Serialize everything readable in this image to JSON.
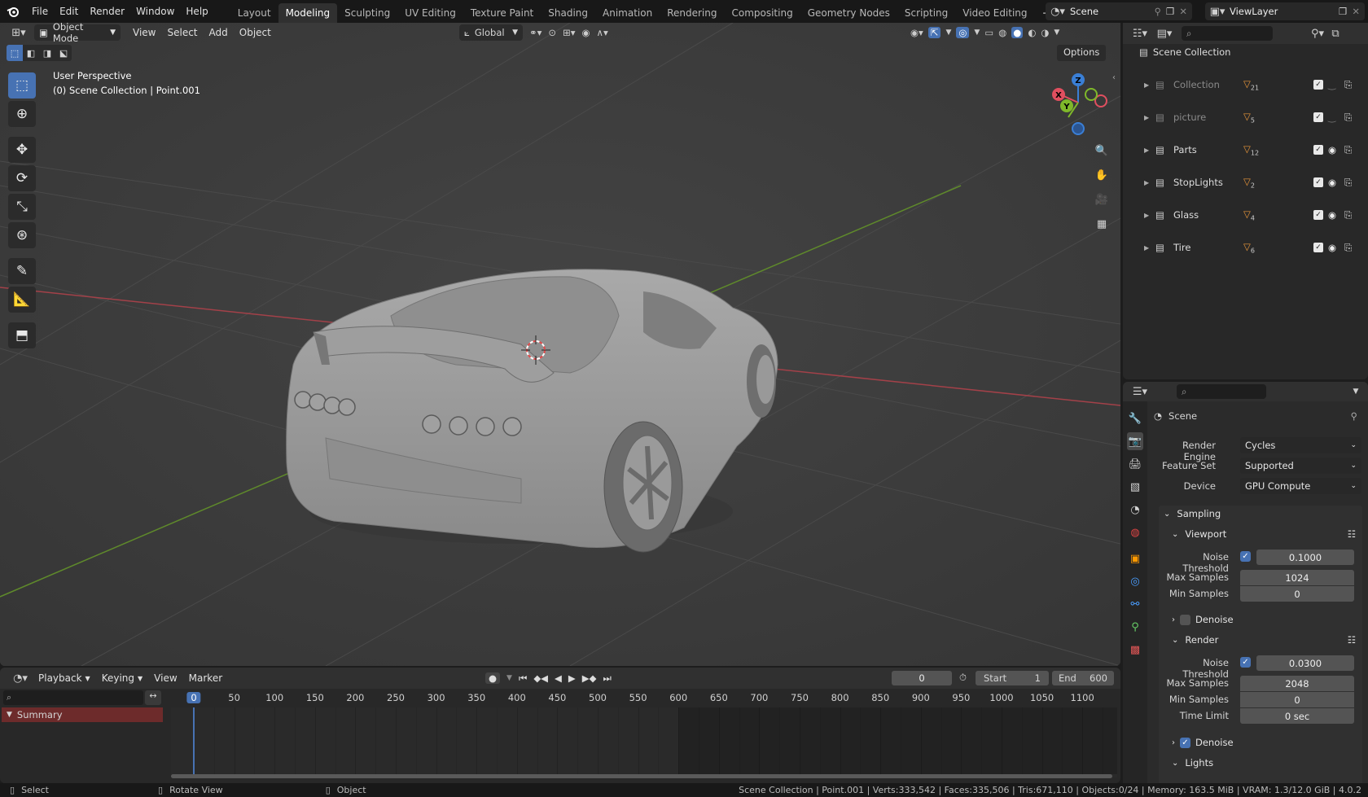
{
  "topbar": {
    "menus": [
      "File",
      "Edit",
      "Render",
      "Window",
      "Help"
    ],
    "workspaces": [
      "Layout",
      "Modeling",
      "Sculpting",
      "UV Editing",
      "Texture Paint",
      "Shading",
      "Animation",
      "Rendering",
      "Compositing",
      "Geometry Nodes",
      "Scripting",
      "Video Editing"
    ],
    "active_workspace": "Modeling",
    "add_tab_icon": "+",
    "scene_name": "Scene",
    "view_layer": "ViewLayer"
  },
  "viewport_header": {
    "mode": "Object Mode",
    "menus": [
      "View",
      "Select",
      "Add",
      "Object"
    ],
    "orientation": "Global",
    "options_label": "Options"
  },
  "viewport": {
    "overlay_line1": "User Perspective",
    "overlay_line2": "(0) Scene Collection | Point.001",
    "gizmo_axes": {
      "x": "X",
      "y": "Y",
      "z": "Z"
    },
    "colors": {
      "x_axis": "#e04f5f",
      "y_axis": "#7fb82a",
      "z_axis": "#3a7fd6",
      "background": "#3d3d3d"
    }
  },
  "outliner": {
    "root": "Scene Collection",
    "items": [
      {
        "name": "Collection",
        "count": "21",
        "dim": true,
        "eye": false
      },
      {
        "name": "picture",
        "count": "5",
        "dim": true,
        "eye": false
      },
      {
        "name": "Parts",
        "count": "12",
        "dim": false,
        "eye": true
      },
      {
        "name": "StopLights",
        "count": "2",
        "dim": false,
        "eye": true
      },
      {
        "name": "Glass",
        "count": "4",
        "dim": false,
        "eye": true
      },
      {
        "name": "Tire",
        "count": "6",
        "dim": false,
        "eye": true
      }
    ]
  },
  "properties": {
    "context": "Scene",
    "render_engine_label": "Render Engine",
    "render_engine": "Cycles",
    "feature_set_label": "Feature Set",
    "feature_set": "Supported",
    "device_label": "Device",
    "device": "GPU Compute",
    "sampling": "Sampling",
    "viewport_section": "Viewport",
    "noise_threshold_label": "Noise Threshold",
    "viewport_noise_threshold": "0.1000",
    "max_samples_label": "Max Samples",
    "viewport_max_samples": "1024",
    "min_samples_label": "Min Samples",
    "viewport_min_samples": "0",
    "denoise_label": "Denoise",
    "render_section": "Render",
    "render_noise_threshold": "0.0300",
    "render_max_samples": "2048",
    "render_min_samples": "0",
    "time_limit_label": "Time Limit",
    "time_limit": "0 sec",
    "lights_section": "Lights"
  },
  "timeline": {
    "menus": [
      "Playback",
      "Keying",
      "View",
      "Marker"
    ],
    "current_frame": "0",
    "start_label": "Start",
    "start": "1",
    "end_label": "End",
    "end": "600",
    "ticks": [
      "0",
      "50",
      "100",
      "150",
      "200",
      "250",
      "300",
      "350",
      "400",
      "450",
      "500",
      "550",
      "600",
      "650",
      "700",
      "750",
      "800",
      "850",
      "900",
      "950",
      "1000",
      "1050",
      "1100"
    ],
    "summary": "Summary"
  },
  "statusbar": {
    "left_action": "Select",
    "middle_action": "Rotate View",
    "right_action": "Object",
    "stats": "Scene Collection | Point.001 | Verts:333,542 | Faces:335,506 | Tris:671,110 | Objects:0/24 | Memory: 163.5 MiB | VRAM: 1.3/12.0 GiB | 4.0.2"
  }
}
